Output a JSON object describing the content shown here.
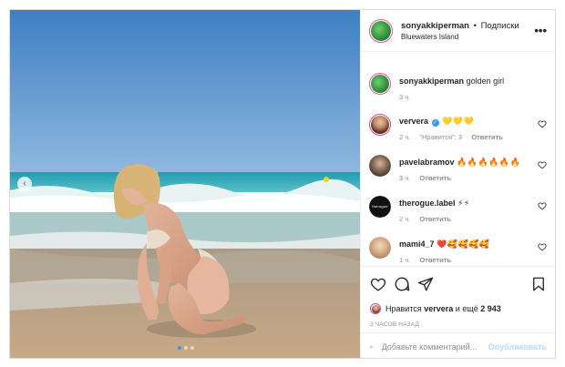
{
  "post": {
    "username": "sonyakkiperman",
    "separator": "•",
    "follow_label": "Подписки",
    "location": "Bluewaters Island",
    "more_icon": "more-horizontal-icon"
  },
  "caption": {
    "username": "sonyakkiperman",
    "text": "golden girl",
    "time": "3 ч."
  },
  "comments": [
    {
      "username": "ververa",
      "verified": true,
      "text": "💛💛💛",
      "time": "2 ч.",
      "likes": "\"Нравится\": 3",
      "reply": "Ответить"
    },
    {
      "username": "pavelabramov",
      "verified": false,
      "text": "🔥🔥🔥🔥🔥🔥",
      "time": "3 ч.",
      "likes": "",
      "reply": "Ответить"
    },
    {
      "username": "therogue.label",
      "verified": false,
      "text": "⚡⚡",
      "time": "2 ч.",
      "likes": "",
      "reply": "Ответить",
      "avatar_text": "therogue"
    },
    {
      "username": "mami4_7",
      "verified": false,
      "text": "❤️🥰🥰🥰🥰",
      "time": "1 ч.",
      "likes": "",
      "reply": "Ответить"
    }
  ],
  "likes": {
    "prefix": "Нравится",
    "user": "ververa",
    "and_more": "и ещё",
    "count": "2 943"
  },
  "time_ago": "3 ЧАСОВ НАЗАД",
  "composer": {
    "placeholder": "Добавьте комментарий...",
    "post_label": "Опубликовать"
  },
  "carousel": {
    "current": 1,
    "total": 3
  },
  "colors": {
    "accent": "#3897f0",
    "text": "#262626",
    "muted": "#8e8e8e",
    "post_disabled": "#b3dbff"
  }
}
